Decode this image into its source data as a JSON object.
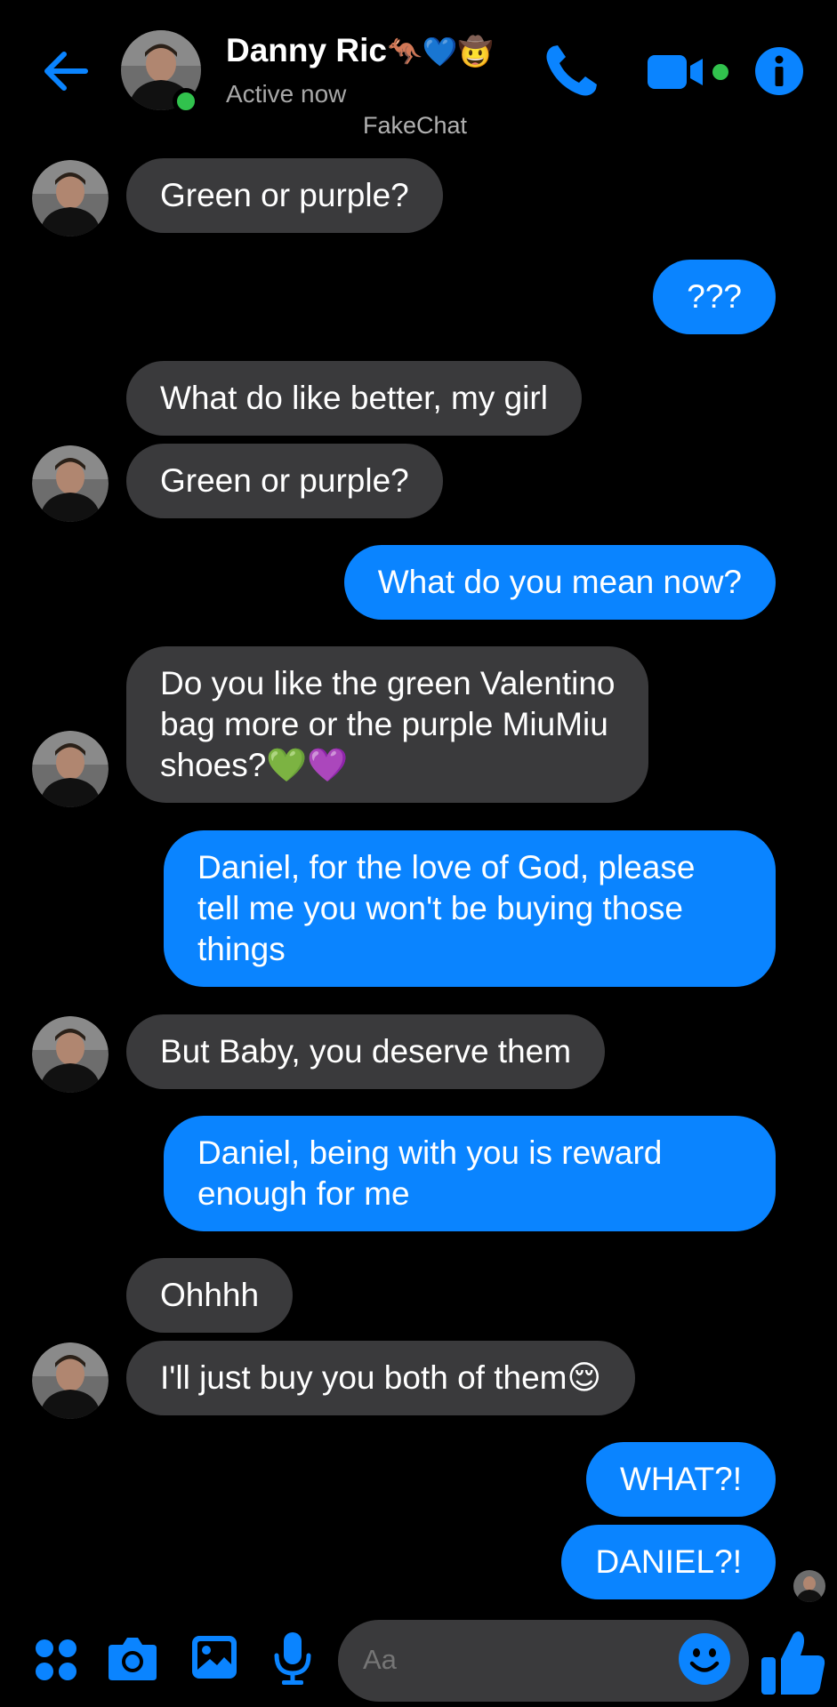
{
  "header": {
    "name": "Danny Ric",
    "name_emojis": "🦘💙🤠",
    "status": "Active now",
    "watermark": "FakeChat"
  },
  "colors": {
    "accent": "#0a84ff",
    "incoming_bubble": "#3a3a3c",
    "online": "#31c24d",
    "background": "#000000"
  },
  "messages": [
    {
      "dir": "in",
      "text": "Green or purple?"
    },
    {
      "dir": "out",
      "text": "???"
    },
    {
      "dir": "in",
      "text": "What do like better, my girl"
    },
    {
      "dir": "in",
      "text": "Green or purple?"
    },
    {
      "dir": "out",
      "text": "What do you mean now?"
    },
    {
      "dir": "in",
      "line1": "Do you like the green Valentino",
      "line2": "bag more or the purple MiuMiu",
      "line3": "shoes?",
      "emojis": "💚💜"
    },
    {
      "dir": "out",
      "line1": "Daniel, for the love of God, please",
      "line2": "tell me you won't be buying those",
      "line3": "things"
    },
    {
      "dir": "in",
      "text": "But Baby, you deserve them"
    },
    {
      "dir": "out",
      "line1": "Daniel, being with you is reward",
      "line2": "enough for me"
    },
    {
      "dir": "in",
      "text": "Ohhhh"
    },
    {
      "dir": "in",
      "text": "I'll just buy you both of them",
      "emoji": "😌"
    },
    {
      "dir": "out",
      "text": "WHAT?!"
    },
    {
      "dir": "out",
      "text": "DANIEL?!"
    }
  ],
  "composer": {
    "placeholder": "Aa"
  },
  "icons": [
    "back-arrow-icon",
    "phone-icon",
    "video-camera-icon",
    "info-icon",
    "apps-grid-icon",
    "camera-icon",
    "image-icon",
    "microphone-icon",
    "smiley-icon",
    "thumbs-up-icon"
  ]
}
